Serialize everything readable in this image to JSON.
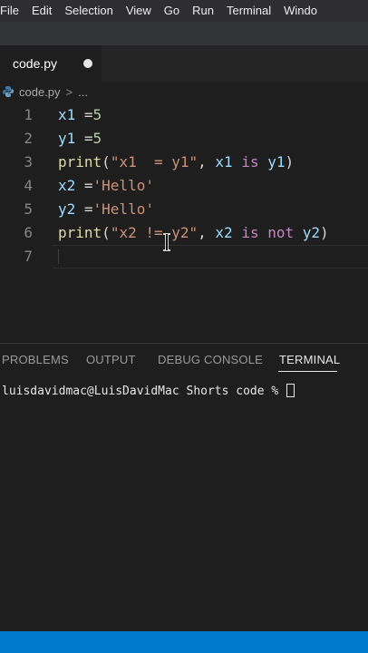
{
  "menubar": {
    "items": [
      "File",
      "Edit",
      "Selection",
      "View",
      "Go",
      "Run",
      "Terminal",
      "Windo"
    ]
  },
  "tab": {
    "filename": "code.py",
    "dirty": true,
    "icon": "python-icon"
  },
  "breadcrumb": {
    "file": "code.py",
    "separator": ">",
    "more": "..."
  },
  "editor": {
    "line_numbers": [
      "1",
      "2",
      "3",
      "4",
      "5",
      "6",
      "7"
    ],
    "current_line": 7,
    "lines": [
      [
        {
          "t": "x1",
          "c": "var"
        },
        {
          "t": " =",
          "c": "op"
        },
        {
          "t": "5",
          "c": "num"
        }
      ],
      [
        {
          "t": "y1",
          "c": "var"
        },
        {
          "t": " =",
          "c": "op"
        },
        {
          "t": "5",
          "c": "num"
        }
      ],
      [
        {
          "t": "print",
          "c": "fn"
        },
        {
          "t": "(",
          "c": "op"
        },
        {
          "t": "\"x1  = y1\"",
          "c": "str"
        },
        {
          "t": ", ",
          "c": "op"
        },
        {
          "t": "x1",
          "c": "var"
        },
        {
          "t": " ",
          "c": "op"
        },
        {
          "t": "is",
          "c": "kw"
        },
        {
          "t": " ",
          "c": "op"
        },
        {
          "t": "y1",
          "c": "var"
        },
        {
          "t": ")",
          "c": "op"
        }
      ],
      [
        {
          "t": "x2",
          "c": "var"
        },
        {
          "t": " =",
          "c": "op"
        },
        {
          "t": "'Hello'",
          "c": "str"
        }
      ],
      [
        {
          "t": "y2",
          "c": "var"
        },
        {
          "t": " =",
          "c": "op"
        },
        {
          "t": "'Hello'",
          "c": "str"
        }
      ],
      [
        {
          "t": "print",
          "c": "fn"
        },
        {
          "t": "(",
          "c": "op"
        },
        {
          "t": "\"x2 != y2\"",
          "c": "str"
        },
        {
          "t": ", ",
          "c": "op"
        },
        {
          "t": "x2",
          "c": "var"
        },
        {
          "t": " ",
          "c": "op"
        },
        {
          "t": "is",
          "c": "kw"
        },
        {
          "t": " ",
          "c": "op"
        },
        {
          "t": "not",
          "c": "kw"
        },
        {
          "t": " ",
          "c": "op"
        },
        {
          "t": "y2",
          "c": "var"
        },
        {
          "t": ")",
          "c": "op"
        }
      ],
      []
    ]
  },
  "panel": {
    "tabs": [
      "PROBLEMS",
      "OUTPUT",
      "DEBUG CONSOLE",
      "TERMINAL"
    ],
    "active_tab": "TERMINAL"
  },
  "terminal": {
    "prompt": "luisdavidmac@LuisDavidMac Shorts code % "
  },
  "colors": {
    "accent": "#007acc",
    "editor_bg": "#1e1e1e",
    "string": "#ce9178",
    "keyword": "#c586c0",
    "function": "#dcdcaa",
    "variable": "#9cdcfe",
    "number": "#b5cea8"
  }
}
